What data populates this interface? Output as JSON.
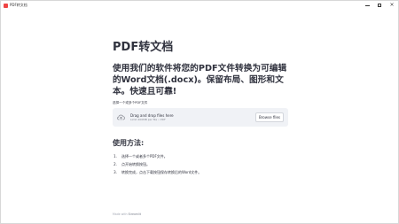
{
  "window": {
    "title": "PDF转文档",
    "controls": [
      "minimize",
      "maximize",
      "close"
    ]
  },
  "main": {
    "title": "PDF转文档",
    "description": "使用我们的软件将您的PDF文件转换为可编辑的Word文档(.docx)。保留布局、图形和文本。快速且可靠!",
    "uploader_label": "选择一个或多个PDF文件",
    "drag_text": "Drag and drop files here",
    "limit_text": "Limit 200MB per file • PDF",
    "browse_button": "Browse files",
    "upload_icon": "cloud-upload-icon",
    "usage_title": "使用方法:",
    "steps": [
      {
        "number": "1.",
        "text": "选择一个或者多个PDF文件。"
      },
      {
        "number": "2.",
        "text": "点开始转换按钮。"
      },
      {
        "number": "3.",
        "text": "转换完成，点击下载按钮保存转换后的Word文件。"
      }
    ],
    "footer_prefix": "Made with ",
    "footer_brand": "Streamlit"
  },
  "colors": {
    "background": "#ffffff",
    "text": "#31333f",
    "uploader_background": "#f0f2f6",
    "button_border": "#d3d6dc",
    "muted": "#888b94",
    "title_icon": "#ef4444"
  }
}
